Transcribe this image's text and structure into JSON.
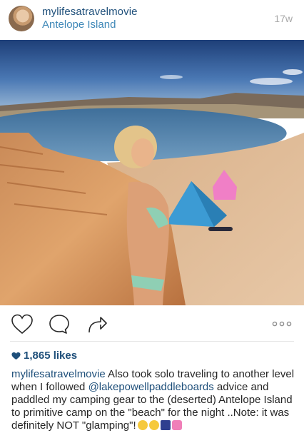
{
  "post": {
    "username": "mylifesatravelmovie",
    "location": "Antelope Island",
    "time_ago": "17w",
    "likes": "1,865 likes",
    "caption": {
      "username": "mylifesatravelmovie",
      "text_1": " Also took solo traveling to another level when I followed ",
      "mention": "@lakepowellpaddleboards",
      "text_2": " advice and paddled my camping gear to the (deserted) Antelope Island to primitive camp on the \"beach\" for the night ..Note: it was definitely NOT \"glamping\"!"
    }
  },
  "icons": {
    "like": "heart-outline-icon",
    "comment": "comment-bubble-icon",
    "share": "share-arrow-icon",
    "more": "more-dots-icon"
  },
  "colors": {
    "username": "#1e4f7a",
    "location": "#3f88b8",
    "timestamp": "#a8a8a8"
  }
}
